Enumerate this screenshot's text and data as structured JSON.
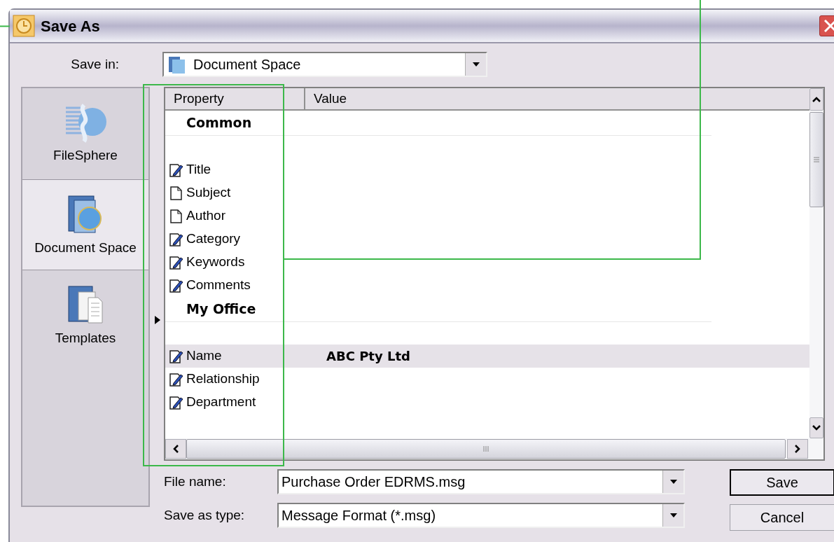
{
  "window": {
    "title": "Save As"
  },
  "save_in": {
    "label": "Save in:",
    "value": "Document Space"
  },
  "places": [
    {
      "label": "FileSphere",
      "kind": "sphere",
      "selected": false
    },
    {
      "label": "Document Space",
      "kind": "globe",
      "selected": true
    },
    {
      "label": "Templates",
      "kind": "templates",
      "selected": false
    }
  ],
  "table": {
    "columns": [
      "Property",
      "Value"
    ],
    "groups": [
      {
        "title": "Common",
        "rows": [
          {
            "property": "Title",
            "kind": "editable",
            "selected": false
          },
          {
            "property": "Subject",
            "kind": "plain",
            "selected": false
          },
          {
            "property": "Author",
            "kind": "plain",
            "selected": false
          },
          {
            "property": "Category",
            "kind": "editable",
            "selected": false
          },
          {
            "property": "Keywords",
            "kind": "editable",
            "selected": false
          },
          {
            "property": "Comments",
            "kind": "editable",
            "selected": false
          }
        ]
      },
      {
        "title": "My Office",
        "rows": [
          {
            "property": "Name",
            "value": "ABC Pty Ltd",
            "kind": "editable",
            "selected": true
          },
          {
            "property": "Relationship",
            "kind": "editable",
            "selected": false
          },
          {
            "property": "Department",
            "kind": "editable",
            "selected": false
          }
        ]
      }
    ]
  },
  "file_name": {
    "label": "File name:",
    "value": "Purchase Order EDRMS.msg"
  },
  "save_as_type": {
    "label": "Save as type:",
    "value": "Message Format (*.msg)"
  },
  "buttons": [
    {
      "label": "Save",
      "kind": "default"
    },
    {
      "label": "Cancel",
      "kind": "normal"
    }
  ]
}
